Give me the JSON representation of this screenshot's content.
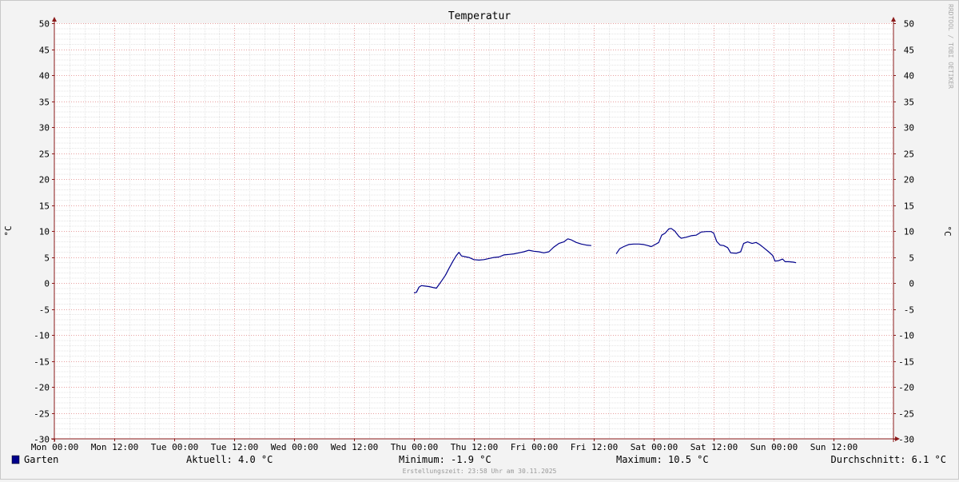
{
  "chart_data": {
    "type": "line",
    "title": "Temperatur",
    "ylabel": "°C",
    "ylim": [
      -30,
      50
    ],
    "y_ticks": [
      50,
      45,
      40,
      35,
      30,
      25,
      20,
      15,
      10,
      5,
      0,
      -5,
      -10,
      -15,
      -20,
      -25,
      -30
    ],
    "x_range_hours": [
      0,
      168
    ],
    "x_ticks": [
      {
        "hour": 0,
        "label": "Mon 00:00"
      },
      {
        "hour": 12,
        "label": "Mon 12:00"
      },
      {
        "hour": 24,
        "label": "Tue 00:00"
      },
      {
        "hour": 36,
        "label": "Tue 12:00"
      },
      {
        "hour": 48,
        "label": "Wed 00:00"
      },
      {
        "hour": 60,
        "label": "Wed 12:00"
      },
      {
        "hour": 72,
        "label": "Thu 00:00"
      },
      {
        "hour": 84,
        "label": "Thu 12:00"
      },
      {
        "hour": 96,
        "label": "Fri 00:00"
      },
      {
        "hour": 108,
        "label": "Fri 12:00"
      },
      {
        "hour": 120,
        "label": "Sat 00:00"
      },
      {
        "hour": 132,
        "label": "Sat 12:00"
      },
      {
        "hour": 144,
        "label": "Sun 00:00"
      },
      {
        "hour": 156,
        "label": "Sun 12:00"
      }
    ],
    "grid": true,
    "series": [
      {
        "name": "Garten",
        "color": "#00008b",
        "segments": [
          [
            [
              72.0,
              -1.9
            ],
            [
              72.5,
              -1.8
            ],
            [
              73.0,
              -0.8
            ],
            [
              73.5,
              -0.5
            ],
            [
              74.2,
              -0.6
            ],
            [
              75.0,
              -0.7
            ],
            [
              76.0,
              -0.9
            ],
            [
              76.5,
              -1.0
            ],
            [
              77.0,
              -0.3
            ],
            [
              77.6,
              0.5
            ],
            [
              78.3,
              1.5
            ],
            [
              79.0,
              2.8
            ],
            [
              79.8,
              4.2
            ],
            [
              80.5,
              5.3
            ],
            [
              81.0,
              5.9
            ],
            [
              81.5,
              5.2
            ],
            [
              82.5,
              5.0
            ],
            [
              83.0,
              4.9
            ],
            [
              84.0,
              4.5
            ],
            [
              85.0,
              4.4
            ],
            [
              86.0,
              4.5
            ],
            [
              87.0,
              4.7
            ],
            [
              88.0,
              4.9
            ],
            [
              89.0,
              5.0
            ],
            [
              90.0,
              5.4
            ],
            [
              91.0,
              5.5
            ],
            [
              92.0,
              5.6
            ],
            [
              93.0,
              5.8
            ],
            [
              94.0,
              6.0
            ],
            [
              95.0,
              6.3
            ],
            [
              96.0,
              6.1
            ],
            [
              97.0,
              6.0
            ],
            [
              98.0,
              5.8
            ],
            [
              99.0,
              6.0
            ],
            [
              100.0,
              6.9
            ],
            [
              101.0,
              7.6
            ],
            [
              102.0,
              7.9
            ],
            [
              102.8,
              8.5
            ],
            [
              103.5,
              8.3
            ],
            [
              104.5,
              7.8
            ],
            [
              105.5,
              7.5
            ],
            [
              106.5,
              7.3
            ],
            [
              107.5,
              7.2
            ]
          ],
          [
            [
              112.5,
              5.6
            ],
            [
              113.2,
              6.6
            ],
            [
              114.0,
              7.0
            ],
            [
              115.0,
              7.4
            ],
            [
              116.0,
              7.5
            ],
            [
              117.0,
              7.5
            ],
            [
              118.0,
              7.4
            ],
            [
              118.8,
              7.2
            ],
            [
              119.5,
              7.0
            ],
            [
              120.3,
              7.4
            ],
            [
              121.0,
              7.8
            ],
            [
              121.6,
              9.2
            ],
            [
              122.3,
              9.6
            ],
            [
              123.0,
              10.4
            ],
            [
              123.5,
              10.5
            ],
            [
              124.2,
              10.0
            ],
            [
              125.0,
              9.0
            ],
            [
              125.5,
              8.6
            ],
            [
              126.5,
              8.8
            ],
            [
              127.5,
              9.1
            ],
            [
              128.5,
              9.2
            ],
            [
              129.5,
              9.8
            ],
            [
              130.5,
              9.9
            ],
            [
              131.5,
              9.9
            ],
            [
              132.0,
              9.6
            ],
            [
              132.6,
              8.0
            ],
            [
              133.3,
              7.3
            ],
            [
              134.0,
              7.2
            ],
            [
              134.8,
              6.8
            ],
            [
              135.4,
              5.8
            ],
            [
              136.5,
              5.7
            ],
            [
              137.4,
              6.0
            ],
            [
              138.0,
              7.6
            ],
            [
              138.8,
              7.9
            ],
            [
              139.7,
              7.6
            ],
            [
              140.5,
              7.8
            ],
            [
              141.2,
              7.4
            ],
            [
              142.0,
              6.8
            ],
            [
              143.0,
              6.0
            ],
            [
              143.8,
              5.3
            ],
            [
              144.3,
              4.2
            ],
            [
              145.0,
              4.3
            ],
            [
              145.8,
              4.6
            ],
            [
              146.3,
              4.1
            ],
            [
              147.0,
              4.1
            ],
            [
              148.0,
              4.0
            ],
            [
              148.5,
              3.9
            ]
          ]
        ]
      }
    ],
    "legend": {
      "name": "Garten",
      "current": "Aktuell: 4.0 °C",
      "minimum": "Minimum: -1.9 °C",
      "maximum": "Maximum: 10.5 °C",
      "average": "Durchschnitt: 6.1 °C"
    },
    "footer": "Erstellungszeit: 23:58 Uhr am 30.11.2025",
    "watermark": "RRDTOOL / TOBI OETIKER"
  }
}
